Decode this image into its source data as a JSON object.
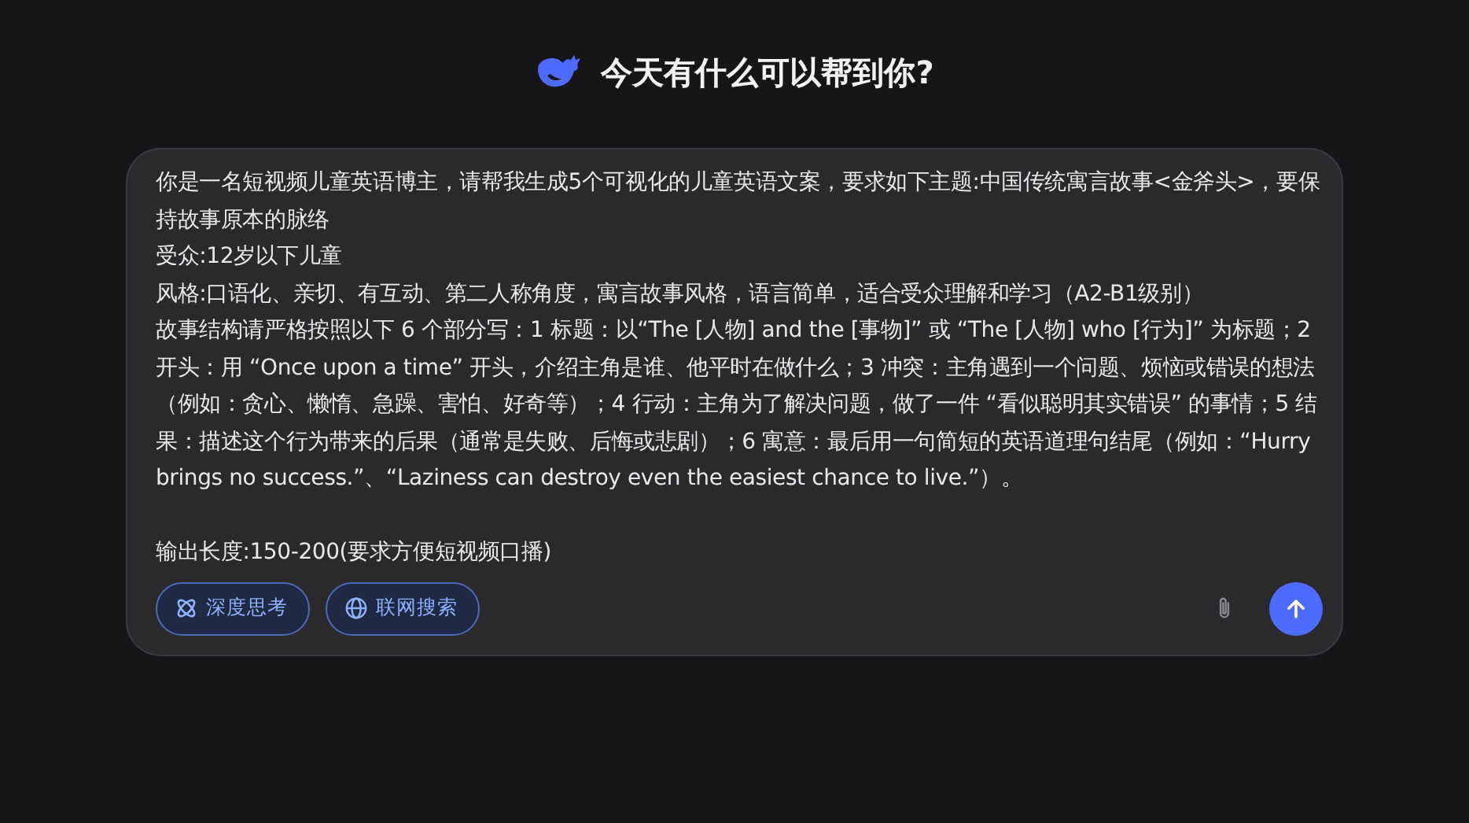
{
  "header": {
    "title": "今天有什么可以帮到你?"
  },
  "composer": {
    "lines": [
      "你是一名短视频儿童英语博主，请帮我生成5个可视化的儿童英语文案，要求如下主题:中国传统寓言故事<金斧头>，要保持故事原本的脉络",
      "受众:12岁以下儿童",
      "风格:口语化、亲切、有互动、第二人称角度，寓言故事风格，语言简单，适合受众理解和学习（A2-B1级别）",
      "故事结构请严格按照以下 6 个部分写：1 标题：以“The [人物] and the [事物]” 或 “The [人物] who [行为]” 为标题；2 开头：用 “Once upon a time” 开头，介绍主角是谁、他平时在做什么；3 冲突：主角遇到一个问题、烦恼或错误的想法（例如：贪心、懒惰、急躁、害怕、好奇等）；4 行动：主角为了解决问题，做了一件 “看似聪明其实错误” 的事情；5 结果：描述这个行为带来的后果（通常是失败、后悔或悲剧）；6 寓意：最后用一句简短的英语道理句结尾（例如：“Hurry brings no success.”、“Laziness can destroy even the easiest chance to live.”）。",
      "输出长度:150-200(要求方便短视频口播)"
    ],
    "toggles": [
      {
        "kind": "deep-think",
        "label": "深度思考",
        "selected": true
      },
      {
        "kind": "web-search",
        "label": "联网搜索",
        "selected": true
      }
    ]
  }
}
